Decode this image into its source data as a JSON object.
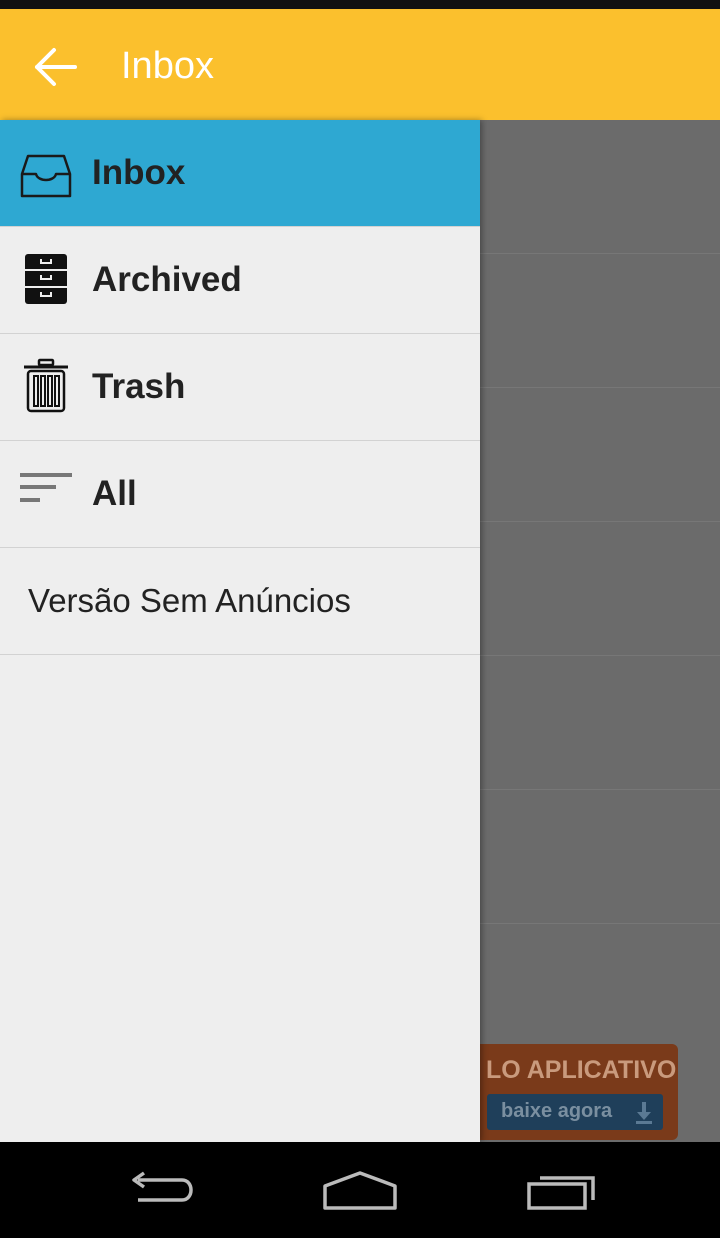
{
  "app_bar": {
    "title": "Inbox",
    "back_icon": "arrow-left-icon",
    "color": "#FBC02D"
  },
  "drawer": {
    "items": [
      {
        "label": "Inbox",
        "icon": "inbox-tray-icon",
        "selected": true
      },
      {
        "label": "Archived",
        "icon": "archive-cabinet-icon",
        "selected": false
      },
      {
        "label": "Trash",
        "icon": "trash-can-icon",
        "selected": false
      },
      {
        "label": "All",
        "icon": "sort-lines-icon",
        "selected": false
      },
      {
        "label": "Versão Sem Anúncios",
        "selected": false
      }
    ],
    "selected_color": "#2EA8D2"
  },
  "ad": {
    "headline": "LO APLICATIVO",
    "button_label": "baixe agora",
    "icon": "download-icon"
  },
  "nav_bar": {
    "icons": [
      "back-nav-icon",
      "home-nav-icon",
      "recents-nav-icon"
    ]
  }
}
